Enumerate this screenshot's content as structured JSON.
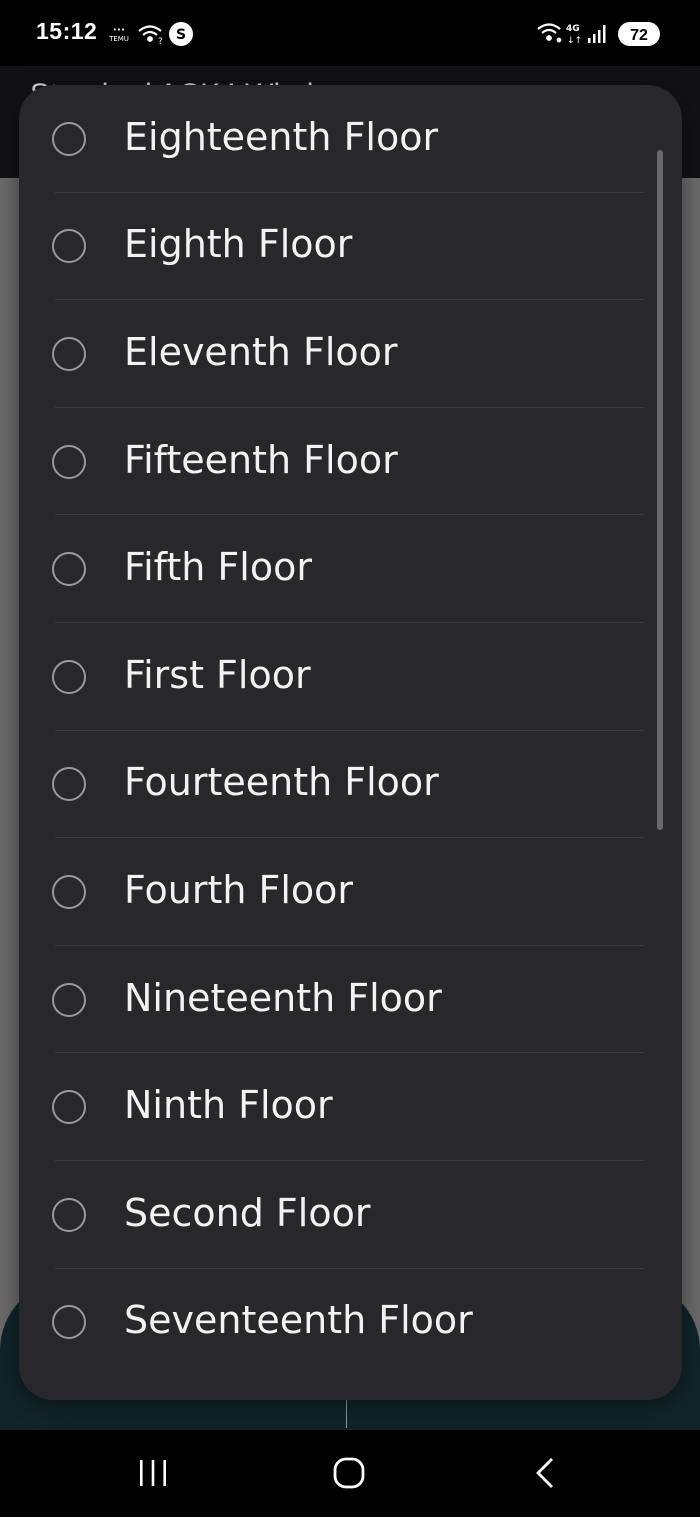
{
  "status": {
    "time": "15:12",
    "battery": "72",
    "network": "4G"
  },
  "header": {
    "title": "Standard ACK4 Wind"
  },
  "dialog": {
    "options": [
      {
        "label": "Eighteenth Floor",
        "selected": false
      },
      {
        "label": "Eighth Floor",
        "selected": false
      },
      {
        "label": "Eleventh Floor",
        "selected": false
      },
      {
        "label": "Fifteenth Floor",
        "selected": false
      },
      {
        "label": "Fifth Floor",
        "selected": false
      },
      {
        "label": "First Floor",
        "selected": false
      },
      {
        "label": "Fourteenth Floor",
        "selected": false
      },
      {
        "label": "Fourth Floor",
        "selected": false
      },
      {
        "label": "Nineteenth Floor",
        "selected": false
      },
      {
        "label": "Ninth Floor",
        "selected": false
      },
      {
        "label": "Second Floor",
        "selected": false
      },
      {
        "label": "Seventeenth Floor",
        "selected": false
      }
    ]
  },
  "colors": {
    "dialog_bg": "#28282a",
    "radio_border": "#9a9a9a",
    "text": "#f2f2f2"
  }
}
